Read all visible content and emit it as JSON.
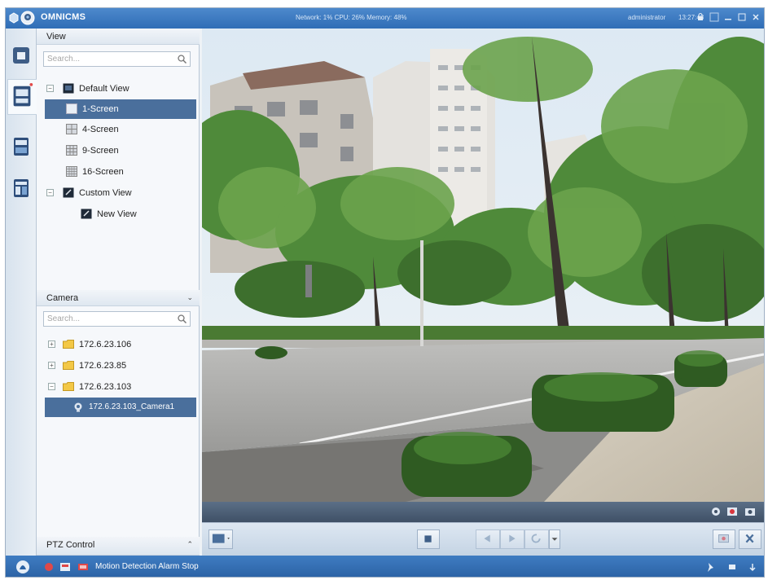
{
  "app": {
    "title": "OMNICMS"
  },
  "titlebar": {
    "status": "Network: 1% CPU: 26% Memory: 48%",
    "user": "administrator",
    "clock": "13:27:48"
  },
  "view_panel": {
    "header": "View",
    "search_placeholder": "Search...",
    "tree": [
      {
        "label": "Default View",
        "level": 0,
        "expander": "-",
        "icon": "monitor-icon"
      },
      {
        "label": "1-Screen",
        "level": 1,
        "icon": "screen-layout-icon",
        "selected": true
      },
      {
        "label": "4-Screen",
        "level": 1,
        "icon": "screen-layout-icon"
      },
      {
        "label": "9-Screen",
        "level": 1,
        "icon": "screen-layout-icon"
      },
      {
        "label": "16-Screen",
        "level": 1,
        "icon": "screen-layout-icon"
      },
      {
        "label": "Custom View",
        "level": 0,
        "expander": "-",
        "icon": "custom-view-icon"
      },
      {
        "label": "New View",
        "level": 1,
        "icon": "new-view-icon"
      }
    ]
  },
  "camera_panel": {
    "header": "Camera",
    "search_placeholder": "Search...",
    "tree": [
      {
        "label": "172.6.23.106",
        "expander": "+",
        "icon": "folder-icon"
      },
      {
        "label": "172.6.23.85",
        "expander": "+",
        "icon": "folder-icon"
      },
      {
        "label": "172.6.23.103",
        "expander": "-",
        "icon": "folder-icon"
      },
      {
        "label": "172.6.23.103_Camera1",
        "icon": "camera-icon",
        "selected": true
      }
    ]
  },
  "ptz_panel": {
    "header": "PTZ Control"
  },
  "statusbar": {
    "alarm_text": "Motion Detection Alarm Stop"
  },
  "colors": {
    "titlebar": "#2f6db6",
    "selection": "#4a6f9c",
    "statusbar": "#2b62a4"
  }
}
